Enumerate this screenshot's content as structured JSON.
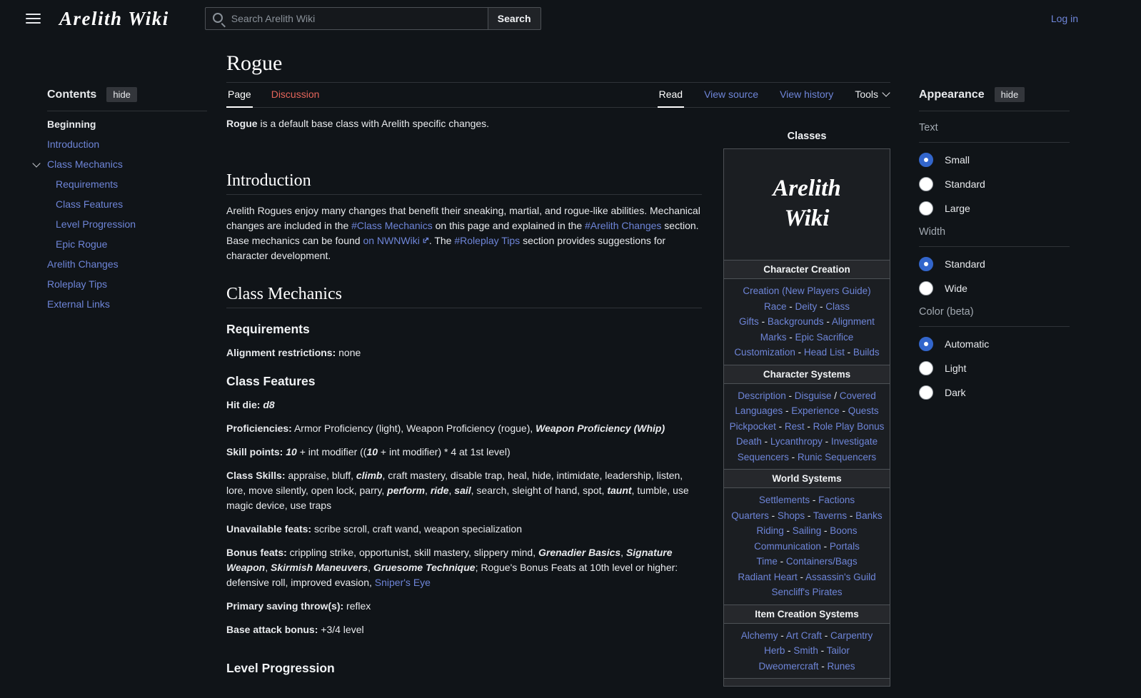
{
  "colors": {
    "link": "#6e85d8",
    "redlink": "#e5655a",
    "radio_selected": "#3366cc",
    "background": "#101418"
  },
  "header": {
    "logo_text": "Arelith Wiki",
    "search_placeholder": "Search Arelith Wiki",
    "search_button": "Search",
    "login": "Log in"
  },
  "toc": {
    "title": "Contents",
    "hide_label": "hide",
    "items": [
      {
        "label": "Beginning",
        "level": 1,
        "active": true
      },
      {
        "label": "Introduction",
        "level": 1
      },
      {
        "label": "Class Mechanics",
        "level": 1,
        "expanded": true
      },
      {
        "label": "Requirements",
        "level": 2
      },
      {
        "label": "Class Features",
        "level": 2
      },
      {
        "label": "Level Progression",
        "level": 2
      },
      {
        "label": "Epic Rogue",
        "level": 2
      },
      {
        "label": "Arelith Changes",
        "level": 1
      },
      {
        "label": "Roleplay Tips",
        "level": 1
      },
      {
        "label": "External Links",
        "level": 1
      }
    ]
  },
  "article": {
    "title": "Rogue",
    "tabs_left": [
      {
        "label": "Page",
        "state": "active"
      },
      {
        "label": "Discussion",
        "state": "redlink"
      }
    ],
    "tabs_right": [
      {
        "label": "Read",
        "state": "active"
      },
      {
        "label": "View source",
        "state": "link"
      },
      {
        "label": "View history",
        "state": "link"
      },
      {
        "label": "Tools",
        "state": "menu"
      }
    ],
    "flow": [
      {
        "type": "p",
        "segments": [
          {
            "text": "Rogue",
            "style": "bold"
          },
          {
            "text": " is a default base class with Arelith specific changes.",
            "style": "plain"
          }
        ]
      },
      {
        "type": "h2",
        "text": "Introduction",
        "cls": "mt-lg"
      },
      {
        "type": "p",
        "segments": [
          {
            "text": "Arelith Rogues enjoy many changes that benefit their sneaking, martial, and rogue-like abilities. Mechanical changes are included in the ",
            "style": "plain"
          },
          {
            "text": "#Class Mechanics",
            "style": "link"
          },
          {
            "text": " on this page and explained in the ",
            "style": "plain"
          },
          {
            "text": "#Arelith Changes",
            "style": "link"
          },
          {
            "text": " section. Base mechanics can be found ",
            "style": "plain"
          },
          {
            "text": "on NWNWiki",
            "style": "ext"
          },
          {
            "text": ". The ",
            "style": "plain"
          },
          {
            "text": "#Roleplay Tips",
            "style": "link"
          },
          {
            "text": " section provides suggestions for character development.",
            "style": "plain"
          }
        ]
      },
      {
        "type": "h2",
        "text": "Class Mechanics"
      },
      {
        "type": "h3",
        "text": "Requirements"
      },
      {
        "type": "p",
        "segments": [
          {
            "text": "Alignment restrictions:",
            "style": "bold"
          },
          {
            "text": " none",
            "style": "plain"
          }
        ]
      },
      {
        "type": "h3",
        "text": "Class Features"
      },
      {
        "type": "p",
        "segments": [
          {
            "text": "Hit die:",
            "style": "bold"
          },
          {
            "text": " ",
            "style": "plain"
          },
          {
            "text": "d8",
            "style": "bi"
          }
        ]
      },
      {
        "type": "p",
        "segments": [
          {
            "text": "Proficiencies:",
            "style": "bold"
          },
          {
            "text": " Armor Proficiency (light), Weapon Proficiency (rogue), ",
            "style": "plain"
          },
          {
            "text": "Weapon Proficiency (Whip)",
            "style": "bi"
          }
        ]
      },
      {
        "type": "p",
        "segments": [
          {
            "text": "Skill points:",
            "style": "bold"
          },
          {
            "text": " ",
            "style": "plain"
          },
          {
            "text": "10",
            "style": "bi"
          },
          {
            "text": " + int modifier ((",
            "style": "plain"
          },
          {
            "text": "10",
            "style": "bi"
          },
          {
            "text": " + int modifier) * 4 at 1st level)",
            "style": "plain"
          }
        ]
      },
      {
        "type": "p",
        "segments": [
          {
            "text": "Class Skills:",
            "style": "bold"
          },
          {
            "text": " appraise, bluff, ",
            "style": "plain"
          },
          {
            "text": "climb",
            "style": "bi"
          },
          {
            "text": ", craft mastery, disable trap, heal, hide, intimidate, leadership, listen, lore, move silently, open lock, parry, ",
            "style": "plain"
          },
          {
            "text": "perform",
            "style": "bi"
          },
          {
            "text": ", ",
            "style": "plain"
          },
          {
            "text": "ride",
            "style": "bi"
          },
          {
            "text": ", ",
            "style": "plain"
          },
          {
            "text": "sail",
            "style": "bi"
          },
          {
            "text": ", search, sleight of hand, spot, ",
            "style": "plain"
          },
          {
            "text": "taunt",
            "style": "bi"
          },
          {
            "text": ", tumble, use magic device, use traps",
            "style": "plain"
          }
        ]
      },
      {
        "type": "p",
        "segments": [
          {
            "text": "Unavailable feats:",
            "style": "bold"
          },
          {
            "text": " scribe scroll, craft wand, weapon specialization",
            "style": "plain"
          }
        ]
      },
      {
        "type": "p",
        "segments": [
          {
            "text": "Bonus feats:",
            "style": "bold"
          },
          {
            "text": " crippling strike, opportunist, skill mastery, slippery mind, ",
            "style": "plain"
          },
          {
            "text": "Grenadier Basics",
            "style": "bi"
          },
          {
            "text": ", ",
            "style": "plain"
          },
          {
            "text": "Signature Weapon",
            "style": "bi"
          },
          {
            "text": ", ",
            "style": "plain"
          },
          {
            "text": "Skirmish Maneuvers",
            "style": "bi"
          },
          {
            "text": ", ",
            "style": "plain"
          },
          {
            "text": "Gruesome Technique",
            "style": "bi"
          },
          {
            "text": "; Rogue's Bonus Feats at 10th level or higher: defensive roll, improved evasion, ",
            "style": "plain"
          },
          {
            "text": "Sniper's Eye",
            "style": "link"
          }
        ]
      },
      {
        "type": "p",
        "segments": [
          {
            "text": "Primary saving throw(s):",
            "style": "bold"
          },
          {
            "text": " reflex",
            "style": "plain"
          }
        ]
      },
      {
        "type": "p",
        "segments": [
          {
            "text": "Base attack bonus:",
            "style": "bold"
          },
          {
            "text": " +3/4 level",
            "style": "plain"
          }
        ]
      },
      {
        "type": "h3",
        "text": "Level Progression",
        "cls": "mt-xl"
      }
    ]
  },
  "infobox": {
    "caption": "Classes",
    "logo_line1": "Arelith",
    "logo_line2": "Wiki",
    "sections": [
      {
        "header": "Character Creation",
        "rows": [
          [
            "Creation (New Players Guide)"
          ],
          [
            "Race",
            " - ",
            "Deity",
            " - ",
            "Class"
          ],
          [
            "Gifts",
            " - ",
            "Backgrounds",
            " - ",
            "Alignment"
          ],
          [
            "Marks",
            " - ",
            "Epic Sacrifice"
          ],
          [
            "Customization",
            " - ",
            "Head List",
            " - ",
            "Builds"
          ]
        ]
      },
      {
        "header": "Character Systems",
        "rows": [
          [
            "Description",
            " - ",
            "Disguise",
            " / ",
            "Covered"
          ],
          [
            "Languages",
            " - ",
            "Experience",
            " - ",
            "Quests"
          ],
          [
            "Pickpocket",
            " - ",
            "Rest",
            " - ",
            "Role Play Bonus"
          ],
          [
            "Death",
            " - ",
            "Lycanthropy",
            " - ",
            "Investigate"
          ],
          [
            "Sequencers",
            " - ",
            "Runic Sequencers"
          ]
        ]
      },
      {
        "header": "World Systems",
        "rows": [
          [
            "Settlements",
            " - ",
            "Factions"
          ],
          [
            "Quarters",
            " - ",
            "Shops",
            " - ",
            "Taverns",
            " - ",
            "Banks"
          ],
          [
            "Riding",
            " - ",
            "Sailing",
            " - ",
            "Boons"
          ],
          [
            "Communication",
            " - ",
            "Portals"
          ],
          [
            "Time",
            " - ",
            "Containers/Bags"
          ],
          [
            "Radiant Heart",
            " - ",
            "Assassin's Guild"
          ],
          [
            "Sencliff's Pirates"
          ]
        ]
      },
      {
        "header": "Item Creation Systems",
        "rows": [
          [
            "Alchemy",
            " - ",
            "Art Craft",
            " - ",
            "Carpentry"
          ],
          [
            "Herb",
            " - ",
            "Smith",
            " - ",
            "Tailor"
          ],
          [
            "Dweomercraft",
            " - ",
            "Runes"
          ]
        ]
      },
      {
        "header": "",
        "rows": [],
        "cut": true
      }
    ]
  },
  "appearance": {
    "title": "Appearance",
    "hide_label": "hide",
    "groups": [
      {
        "label": "Text",
        "options": [
          {
            "label": "Small",
            "selected": true
          },
          {
            "label": "Standard",
            "selected": false
          },
          {
            "label": "Large",
            "selected": false
          }
        ]
      },
      {
        "label": "Width",
        "options": [
          {
            "label": "Standard",
            "selected": true
          },
          {
            "label": "Wide",
            "selected": false
          }
        ]
      },
      {
        "label": "Color (beta)",
        "options": [
          {
            "label": "Automatic",
            "selected": true
          },
          {
            "label": "Light",
            "selected": false
          },
          {
            "label": "Dark",
            "selected": false
          }
        ]
      }
    ]
  }
}
